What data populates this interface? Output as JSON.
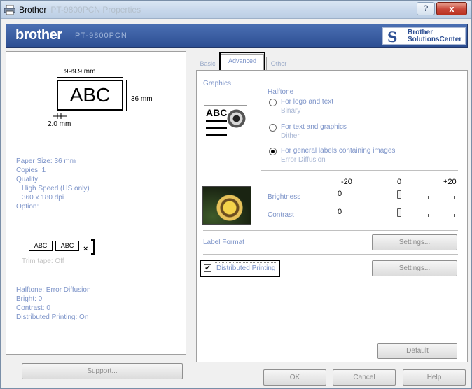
{
  "titlebar": {
    "app_name": "Brother",
    "blurred_title": "PT-9800PCN Properties",
    "help_label": "?",
    "close_label": "x"
  },
  "brand": {
    "logo": "brother",
    "model": "PT-9800PCN",
    "solutions_line1": "Brother",
    "solutions_line2": "SolutionsCenter",
    "accent_color": "#2d4f93"
  },
  "preview": {
    "width_label": "999.9 mm",
    "height_label": "36 mm",
    "margin_label": "2.0 mm",
    "sample_text": "ABC"
  },
  "summary": {
    "paper_size": "Paper Size: 36 mm",
    "copies": "Copies: 1",
    "quality": "Quality:",
    "quality_mode": "High Speed (HS only)",
    "resolution": "360 x 180 dpi",
    "option": "Option:",
    "tape_seg1": "ABC",
    "tape_seg2": "ABC",
    "trim_tape": "Trim tape: Off",
    "halftone": "Halftone: Error Diffusion",
    "bright": "Bright: 0",
    "contrast": "Contrast: 0",
    "distributed": "Distributed Printing: On"
  },
  "left_button": "Support...",
  "tabs": [
    {
      "label": "Basic"
    },
    {
      "label": "Advanced"
    },
    {
      "label": "Other"
    }
  ],
  "advanced": {
    "graphics_label": "Graphics",
    "graphic_sample": "ABC",
    "halftone_title": "Halftone",
    "options": [
      {
        "label": "For logo and text",
        "sub": "Binary",
        "selected": false
      },
      {
        "label": "For text and graphics",
        "sub": "Dither",
        "selected": false
      },
      {
        "label": "For general labels containing images",
        "sub": "Error Diffusion",
        "selected": true
      }
    ],
    "scale": {
      "min": "-20",
      "mid": "0",
      "max": "+20"
    },
    "brightness_label": "Brightness",
    "brightness_value": "0",
    "contrast_label": "Contrast",
    "contrast_value": "0",
    "label_format": "Label Format",
    "settings_label": "Settings...",
    "distributed_label": "Distributed Printing",
    "distributed_checked": "✔",
    "settings2_label": "Settings...",
    "default_label": "Default"
  },
  "footer": {
    "ok": "OK",
    "cancel": "Cancel",
    "help": "Help"
  }
}
